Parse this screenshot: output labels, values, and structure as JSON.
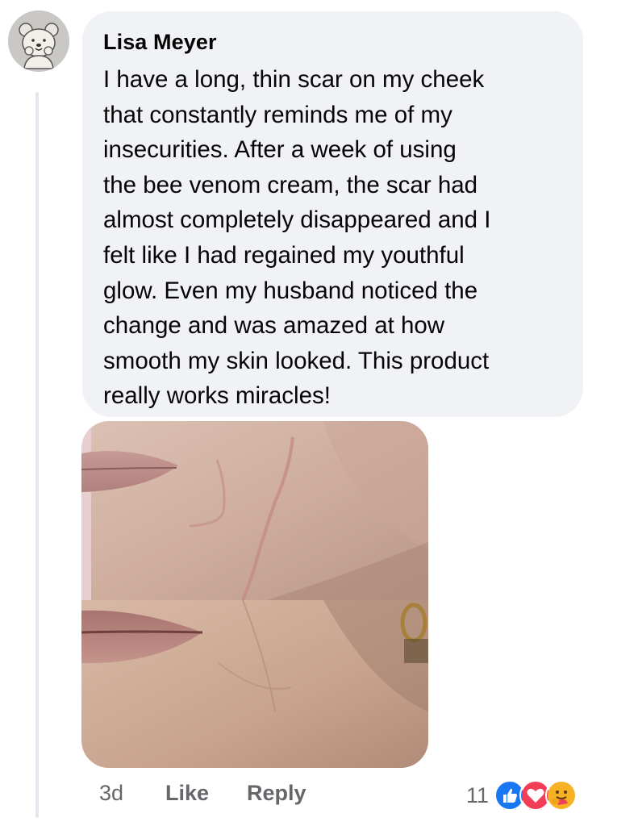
{
  "comment": {
    "author": "Lisa Meyer",
    "text": "I have a long, thin scar on my cheek\nthat constantly reminds me of my\ninsecurities. After a week of using\nthe bee venom cream, the scar had\nalmost completely disappeared and I\nfelt like I had regained my youthful\nglow. Even my husband noticed the\nchange and was amazed at how\nsmooth my skin looked. This product\nreally works miracles!",
    "avatar_icon": "bear-cartoon-avatar"
  },
  "photo": {
    "icon": "before-after-skin-photo"
  },
  "actions": {
    "time": "3d",
    "like_label": "Like",
    "reply_label": "Reply"
  },
  "reactions": {
    "count": "11",
    "icons": [
      "like-reaction-icon",
      "love-reaction-icon",
      "care-reaction-icon"
    ]
  },
  "colors": {
    "bubble_bg": "#f0f2f5",
    "text": "#050505",
    "meta_text": "#65676b",
    "like_blue": "#1877f2",
    "love_red": "#f33e58",
    "care_yellow": "#f7b125"
  }
}
